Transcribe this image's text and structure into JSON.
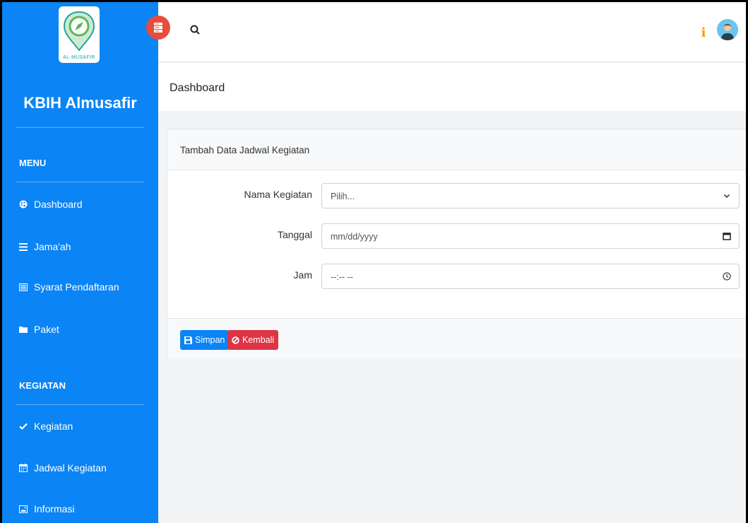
{
  "brand": {
    "logo_text": "AL-MUSAFIR",
    "name": "KBIH Almusafir"
  },
  "sidebar": {
    "sections": [
      {
        "title": "MENU",
        "items": [
          {
            "label": "Dashboard",
            "icon": "palette-icon"
          },
          {
            "label": "Jama'ah",
            "icon": "list-icon"
          },
          {
            "label": "Syarat Pendaftaran",
            "icon": "list-alt-icon"
          },
          {
            "label": "Paket",
            "icon": "folder-icon"
          }
        ]
      },
      {
        "title": "KEGIATAN",
        "items": [
          {
            "label": "Kegiatan",
            "icon": "check-icon"
          },
          {
            "label": "Jadwal Kegiatan",
            "icon": "calendar-icon"
          },
          {
            "label": "Informasi",
            "icon": "image-icon"
          }
        ]
      }
    ]
  },
  "page": {
    "title": "Dashboard"
  },
  "card": {
    "title": "Tambah Data Jadwal Kegiatan",
    "fields": [
      {
        "label": "Nama Kegiatan",
        "value": "Pilih...",
        "type": "select"
      },
      {
        "label": "Tanggal",
        "value": "mm/dd/yyyy",
        "type": "date"
      },
      {
        "label": "Jam",
        "value": "--:-- --",
        "type": "time"
      }
    ],
    "buttons": {
      "save": "Simpan",
      "back": "Kembali"
    }
  },
  "colors": {
    "sidebar": "#0b84f5",
    "toggle": "#e74c3c",
    "primary": "#0b84f5",
    "danger": "#dc3545",
    "info_icon": "#f39c12"
  }
}
